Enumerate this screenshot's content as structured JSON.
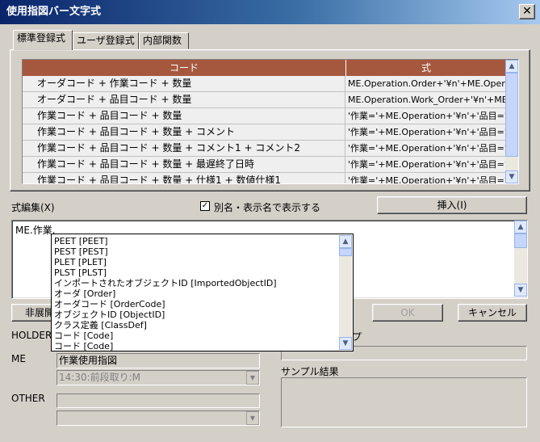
{
  "window": {
    "title": "使用指図バー文字式",
    "close_glyph": "✕"
  },
  "tabs": [
    {
      "label": "標準登録式"
    },
    {
      "label": "ユーザ登録式"
    },
    {
      "label": "内部関数"
    }
  ],
  "grid": {
    "headers": [
      "コード",
      "式"
    ],
    "rows": [
      {
        "code": "オーダコード + 作業コード + 数量",
        "expr": "ME.Operation.Order+'¥n'+ME.Operation."
      },
      {
        "code": "オーダコード + 品目コード + 数量",
        "expr": "ME.Operation.Work_Order+'¥n'+ME.Ope"
      },
      {
        "code": "作業コード + 品目コード + 数量",
        "expr": "'作業='+ME.Operation+'¥n'+'品目='+ME."
      },
      {
        "code": "作業コード + 品目コード + 数量 + コメント",
        "expr": "'作業='+ME.Operation+'¥n'+'品目='+ME."
      },
      {
        "code": "作業コード + 品目コード + 数量 + コメント1 + コメント2",
        "expr": "'作業='+ME.Operation+'¥n'+'品目='+ME."
      },
      {
        "code": "作業コード + 品目コード + 数量 + 最遅終了日時",
        "expr": "'作業='+ME.Operation+'¥n'+'品目='+ME."
      },
      {
        "code": "作業コード + 品目コード + 数量 + 仕様1 + 数値仕様1",
        "expr": "'作業='+ME.Operation+'¥n'+'品目='+ME."
      }
    ]
  },
  "editor": {
    "label": "式編集(X)",
    "checkbox_label": "別名・表示名で表示する",
    "checkbox_checked": true,
    "insert_button": "挿入(I)",
    "text": "ME.作業."
  },
  "autocomplete": {
    "items": [
      "PEET [PEET]",
      "PEST [PEST]",
      "PLET [PLET]",
      "PLST [PLST]",
      "インポートされたオブジェクトID [ImportedObjectID]",
      "オーダ [Order]",
      "オーダコード [OrderCode]",
      "オブジェクトID [ObjectID]",
      "クラス定義 [ClassDef]",
      "コード [Code]",
      "コード [Code]"
    ]
  },
  "buttons": {
    "collapse": "非展開",
    "ok": "OK",
    "cancel": "キャンセル"
  },
  "left_panel": {
    "holder_label": "HOLDER",
    "me_label": "ME",
    "me_value": "作業使用指図",
    "me_combo": "14:30:前段取り:M",
    "other_label": "OTHER"
  },
  "right_panel": {
    "type_label": "プ",
    "sample_label": "サンプル結果"
  },
  "colors": {
    "title_start": "#0a246a",
    "title_end": "#a6caf0",
    "grid_header": "#a6583f",
    "dialog_bg": "#d4d0c8"
  }
}
